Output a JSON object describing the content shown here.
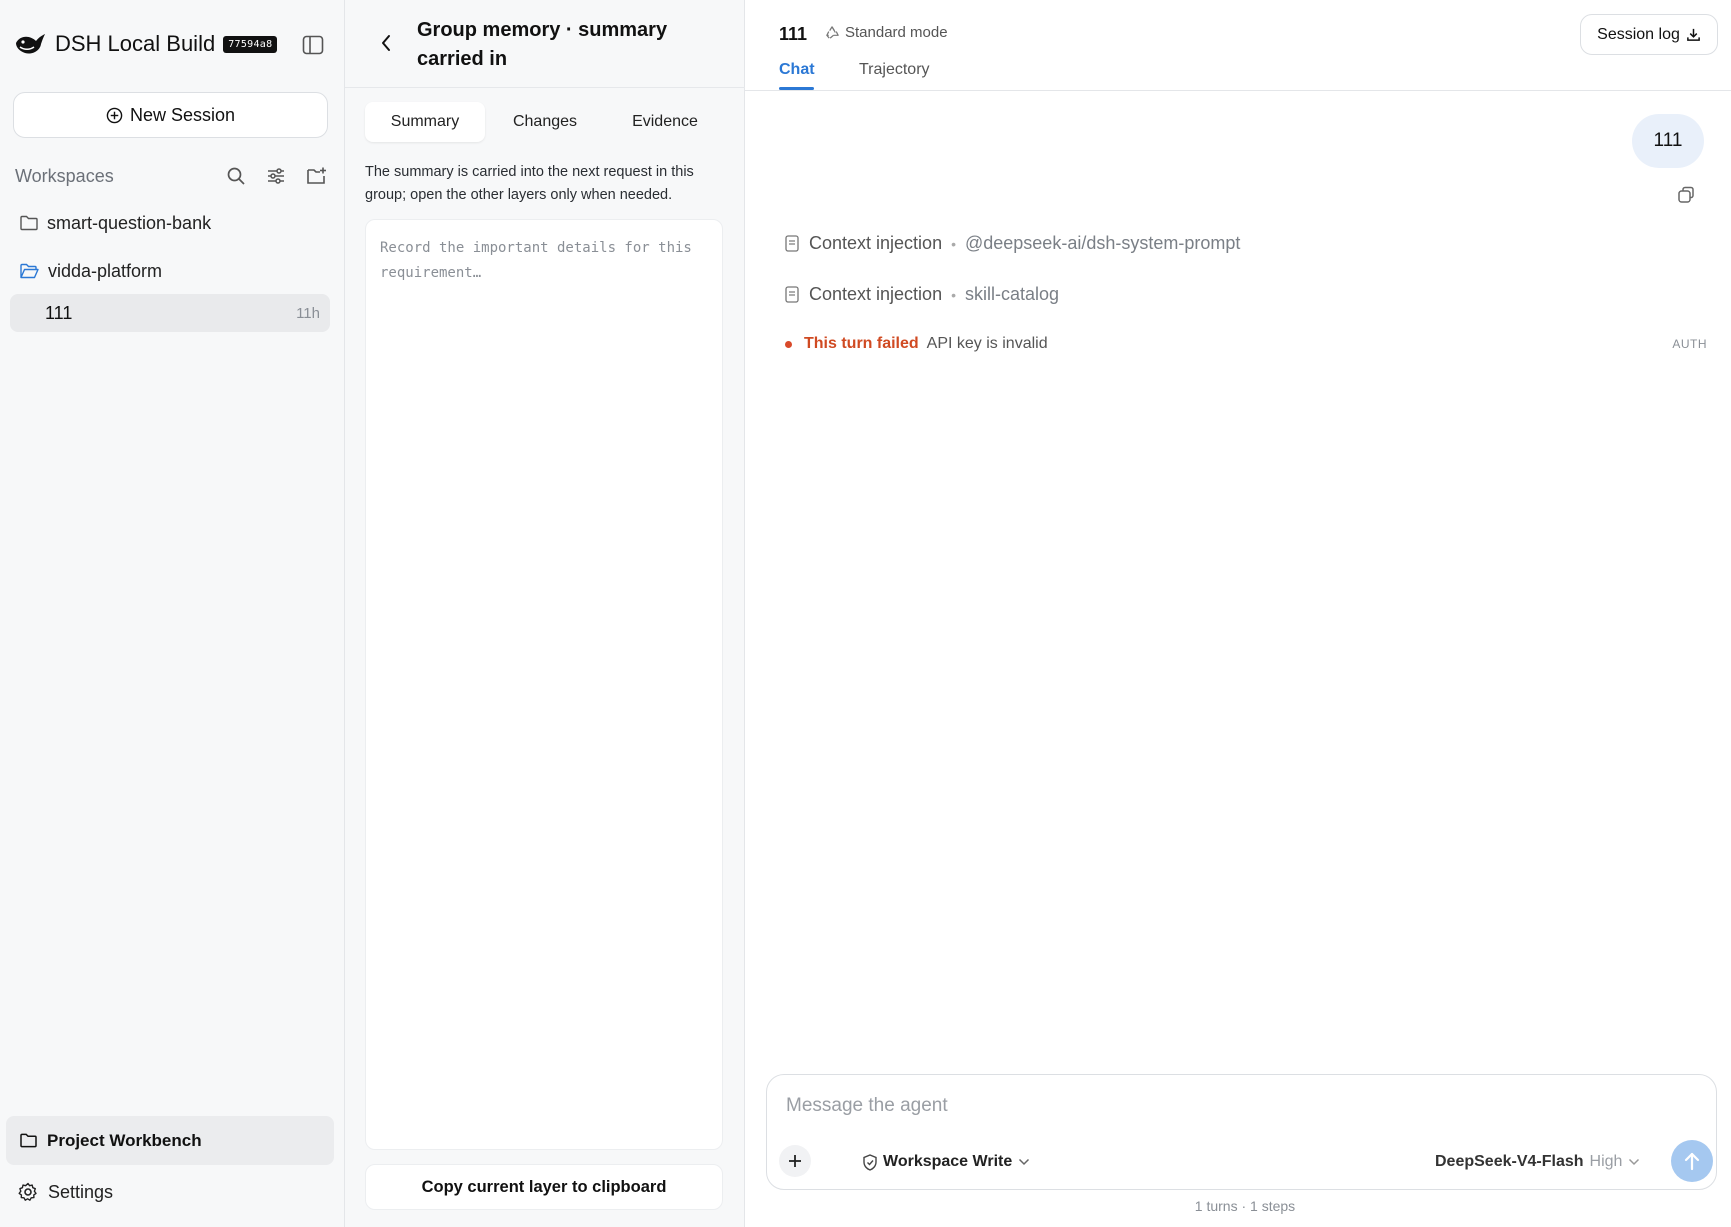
{
  "sidebar": {
    "brand_title": "DSH Local Build",
    "brand_badge": "77594a8",
    "new_session_label": "New Session",
    "workspaces_title": "Workspaces",
    "workspaces": [
      {
        "name": "smart-question-bank"
      },
      {
        "name": "vidda-platform"
      }
    ],
    "session": {
      "name": "111",
      "time": "11h"
    },
    "project_workbench_label": "Project Workbench",
    "settings_label": "Settings"
  },
  "memory": {
    "title": "Group memory · summary carried in",
    "tabs": [
      {
        "label": "Summary",
        "active": true
      },
      {
        "label": "Changes",
        "active": false
      },
      {
        "label": "Evidence",
        "active": false
      }
    ],
    "description": "The summary is carried into the next request in this group; open the other layers only when needed.",
    "editor_placeholder": "Record the important details for this requirement…",
    "copy_label": "Copy current layer to clipboard"
  },
  "main": {
    "session_title": "111",
    "mode_label": "Standard mode",
    "session_log_label": "Session log",
    "tabs": [
      {
        "label": "Chat",
        "active": true
      },
      {
        "label": "Trajectory",
        "active": false
      }
    ],
    "user_message": "111",
    "context_injections": [
      {
        "label": "Context injection",
        "target": "@deepseek-ai/dsh-system-prompt"
      },
      {
        "label": "Context injection",
        "target": "skill-catalog"
      }
    ],
    "failure": {
      "label": "This turn failed",
      "message": "API key is invalid",
      "code": "AUTH"
    },
    "composer": {
      "placeholder": "Message the agent",
      "permission": "Workspace Write",
      "model": "DeepSeek-V4-Flash",
      "effort": "High"
    },
    "stats": "1 turns · 1 steps"
  },
  "colors": {
    "accent": "#2b78d5",
    "error": "#d04a22",
    "send_button": "#a5c8f0",
    "user_bubble": "#e9f0fa",
    "workspace_folder_active": "#2b78d5"
  }
}
